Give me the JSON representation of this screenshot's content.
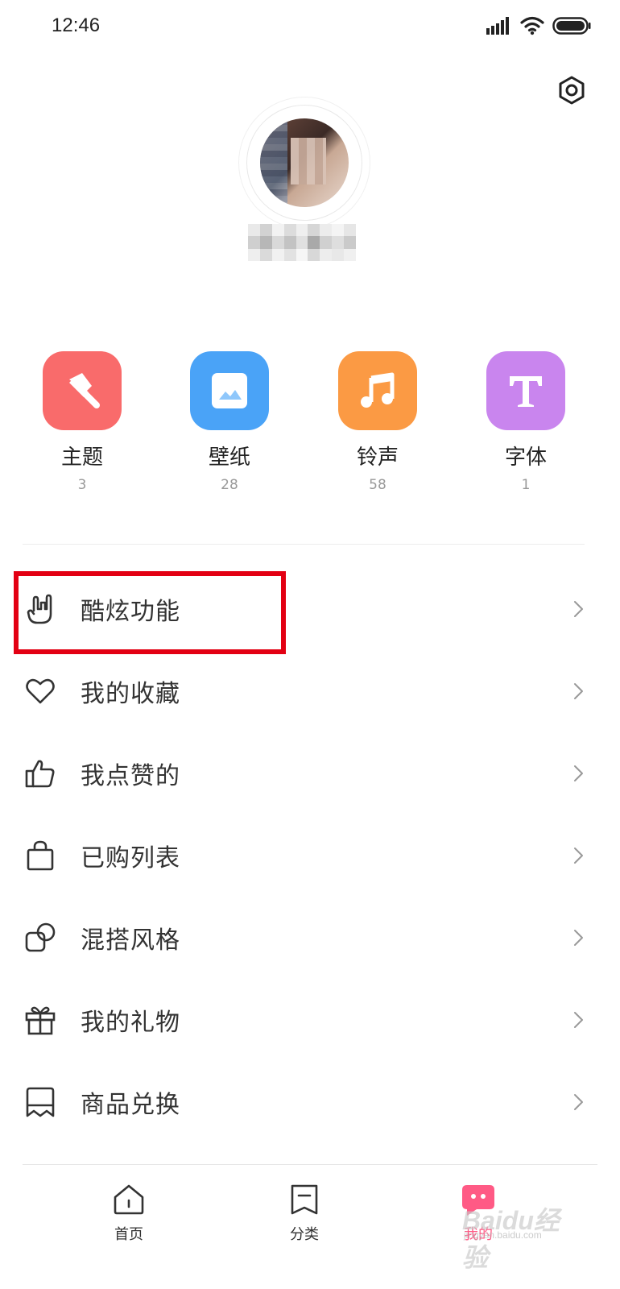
{
  "status_bar": {
    "time": "12:46"
  },
  "settings": {
    "icon": "settings-hexagon-icon"
  },
  "profile": {
    "avatar": "blurred-profile-photo",
    "username": ""
  },
  "quick_entries": [
    {
      "label": "主题",
      "count": "3",
      "icon": "brush-icon",
      "color": "#f96b6b"
    },
    {
      "label": "壁纸",
      "count": "28",
      "icon": "image-icon",
      "color": "#4aa3f7"
    },
    {
      "label": "铃声",
      "count": "58",
      "icon": "music-note-icon",
      "color": "#fb9a44"
    },
    {
      "label": "字体",
      "count": "1",
      "icon": "letter-t-icon",
      "color": "#c985ee"
    }
  ],
  "menu": [
    {
      "label": "酷炫功能",
      "icon": "rock-hand-icon"
    },
    {
      "label": "我的收藏",
      "icon": "heart-icon"
    },
    {
      "label": "我点赞的",
      "icon": "thumbs-up-icon"
    },
    {
      "label": "已购列表",
      "icon": "shopping-bag-icon"
    },
    {
      "label": "混搭风格",
      "icon": "mix-shapes-icon"
    },
    {
      "label": "我的礼物",
      "icon": "gift-icon"
    },
    {
      "label": "商品兑换",
      "icon": "exchange-ticket-icon"
    }
  ],
  "tabbar": [
    {
      "label": "首页",
      "icon": "home-icon",
      "active": false
    },
    {
      "label": "分类",
      "icon": "category-bookmark-icon",
      "active": false
    },
    {
      "label": "我的",
      "icon": "profile-bubble-icon",
      "active": true
    }
  ],
  "colors": {
    "highlight_box": "#e30013",
    "active_tab": "#ff5a85"
  },
  "watermark": {
    "brand": "Baidu经验",
    "sub": "jingyan.baidu.com"
  }
}
